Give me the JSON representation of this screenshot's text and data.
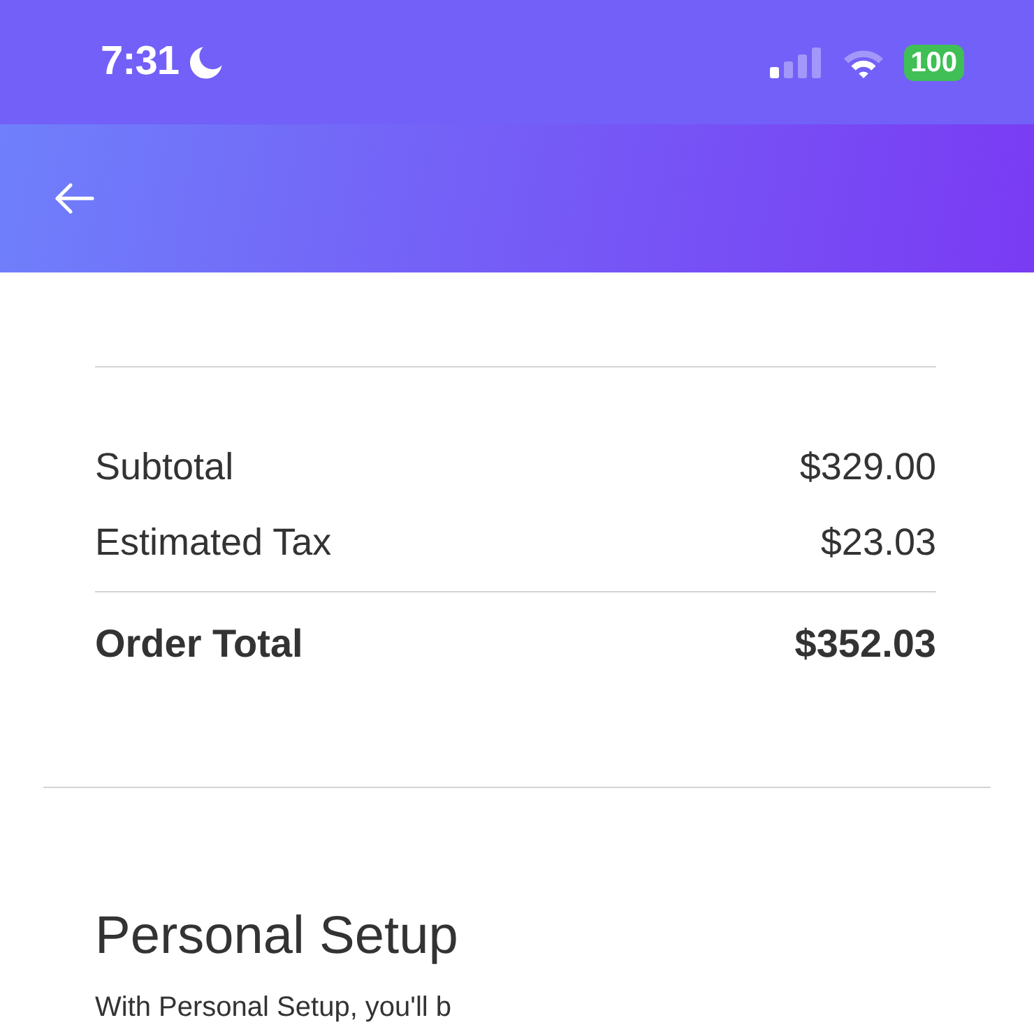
{
  "status_bar": {
    "time": "7:31",
    "battery": "100"
  },
  "summary": {
    "rows": [
      {
        "label": "Subtotal",
        "value": "$329.00",
        "kind": "line"
      },
      {
        "label": "Estimated Tax",
        "value": "$23.03",
        "kind": "line"
      },
      {
        "label": "Order Total",
        "value": "$352.03",
        "kind": "total"
      }
    ]
  },
  "personal_setup": {
    "title": "Personal Setup",
    "description": "With Personal Setup, you'll b"
  }
}
